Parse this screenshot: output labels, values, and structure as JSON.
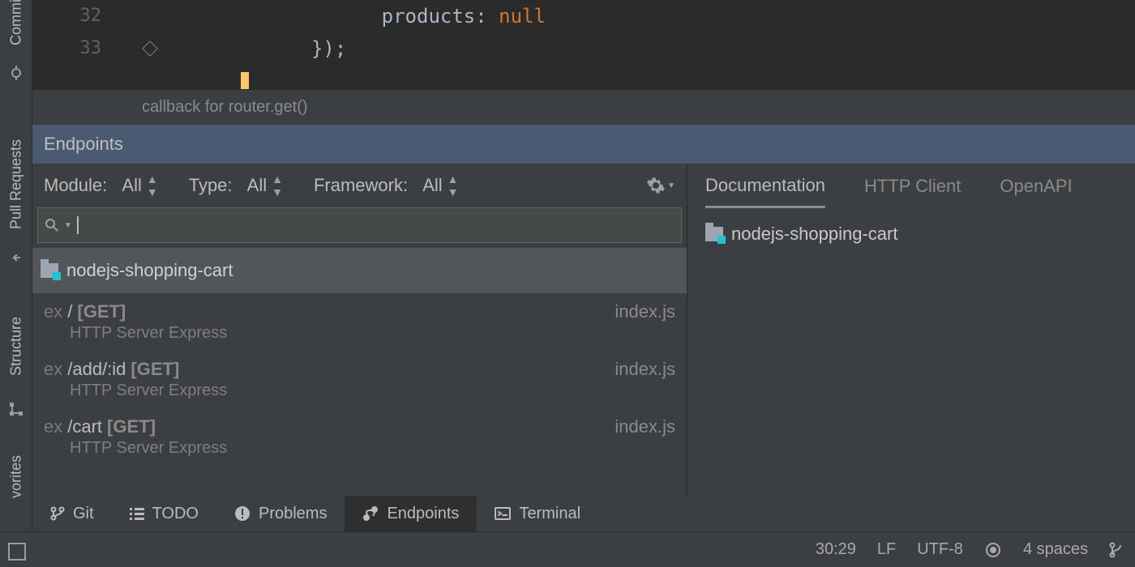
{
  "sidebar": {
    "tabs": [
      "Commi",
      "Pull Requests",
      "Structure",
      "vorites"
    ]
  },
  "editor": {
    "lines": [
      {
        "num": "32",
        "indent": "                 ",
        "prop": "products: ",
        "value": "null"
      },
      {
        "num": "33",
        "indent": "           ",
        "text": "});"
      }
    ]
  },
  "breadcrumb": "callback for router.get()",
  "tool": {
    "title": "Endpoints",
    "filters": {
      "module_label": "Module:",
      "module_value": "All",
      "type_label": "Type:",
      "type_value": "All",
      "fw_label": "Framework:",
      "fw_value": "All"
    },
    "search_placeholder": "",
    "group": "nodejs-shopping-cart",
    "endpoints": [
      {
        "prefix": "ex ",
        "path": "/",
        "method": "[GET]",
        "file": "index.js",
        "meta": "HTTP Server   Express"
      },
      {
        "prefix": "ex ",
        "path": "/add/:id",
        "method": "[GET]",
        "file": "index.js",
        "meta": "HTTP Server   Express"
      },
      {
        "prefix": "ex ",
        "path": "/cart",
        "method": "[GET]",
        "file": "index.js",
        "meta": "HTTP Server   Express"
      }
    ],
    "right_tabs": [
      "Documentation",
      "HTTP Client",
      "OpenAPI"
    ],
    "doc_title": "nodejs-shopping-cart"
  },
  "bottom_tabs": [
    "Git",
    "TODO",
    "Problems",
    "Endpoints",
    "Terminal"
  ],
  "status": {
    "caret": "30:29",
    "eol": "LF",
    "enc": "UTF-8",
    "indent": "4 spaces"
  }
}
